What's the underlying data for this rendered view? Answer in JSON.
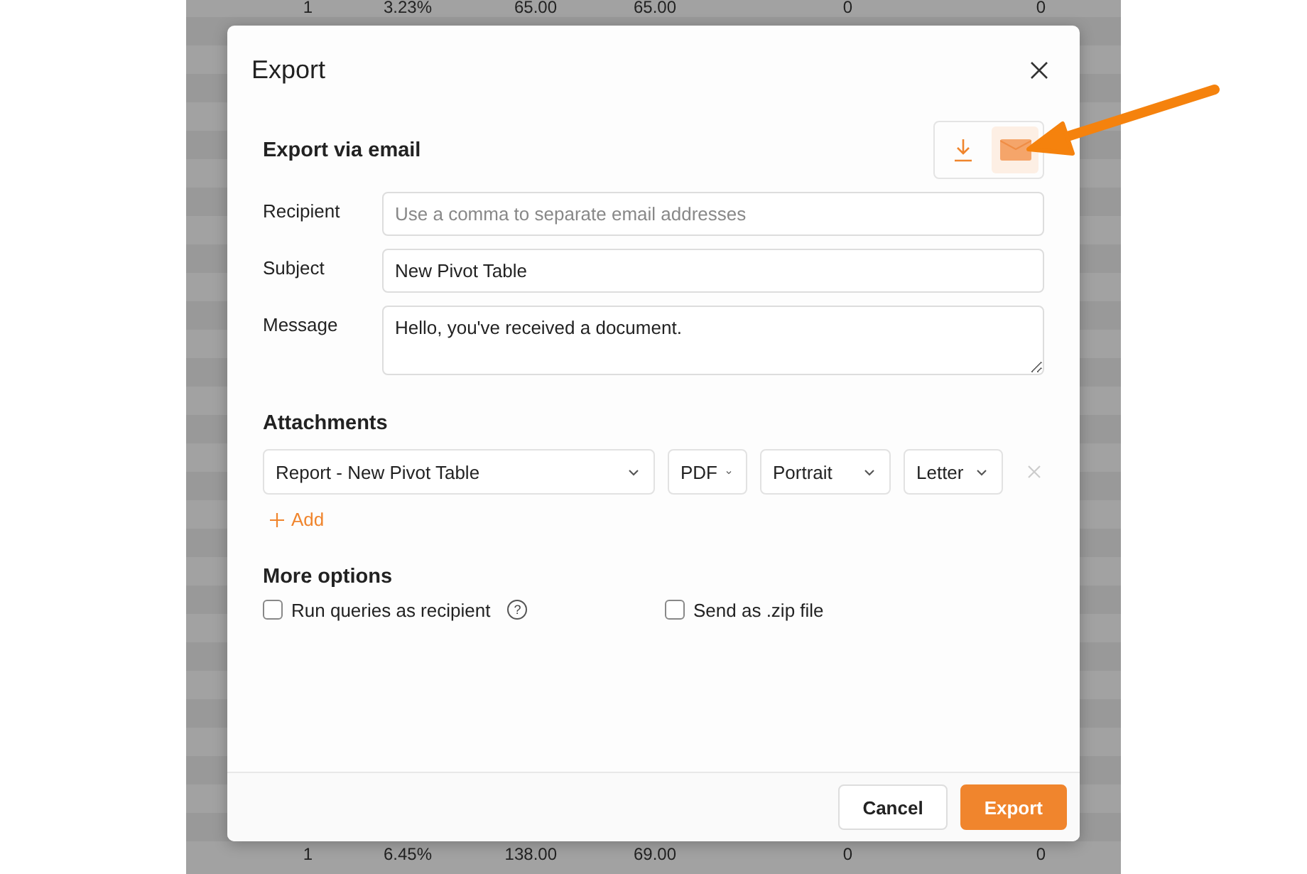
{
  "background_table": {
    "rows": [
      {
        "cells": [
          "1",
          "3.23%",
          "65.00",
          "65.00",
          "0",
          "0"
        ]
      },
      {
        "cells": [
          "1",
          "6.45%",
          "138.00",
          "69.00",
          "0",
          "0"
        ]
      }
    ]
  },
  "dialog": {
    "title": "Export",
    "mode_toggle": [
      {
        "kind": "download",
        "selected": false
      },
      {
        "kind": "email",
        "selected": true
      }
    ],
    "section_title": "Export via email",
    "fields": [
      {
        "label": "Recipient",
        "kind": "input",
        "placeholder": "Use a comma to separate email addresses"
      },
      {
        "label": "Subject",
        "kind": "input",
        "value": "New Pivot Table"
      },
      {
        "label": "Message",
        "kind": "textarea",
        "value": "Hello, you've received a document."
      }
    ],
    "attachments": {
      "title": "Attachments",
      "items": [
        {
          "report": "Report - New Pivot Table",
          "format": "PDF",
          "orientation": "Portrait",
          "paper": "Letter"
        }
      ],
      "add_label": "Add"
    },
    "more_options": {
      "title": "More options",
      "options": [
        {
          "label": "Run queries as recipient",
          "checked": false,
          "help": "?"
        },
        {
          "label": "Send as .zip file",
          "checked": false
        }
      ]
    },
    "buttons": [
      {
        "label": "Cancel",
        "kind": "secondary"
      },
      {
        "label": "Export",
        "kind": "primary"
      }
    ]
  }
}
